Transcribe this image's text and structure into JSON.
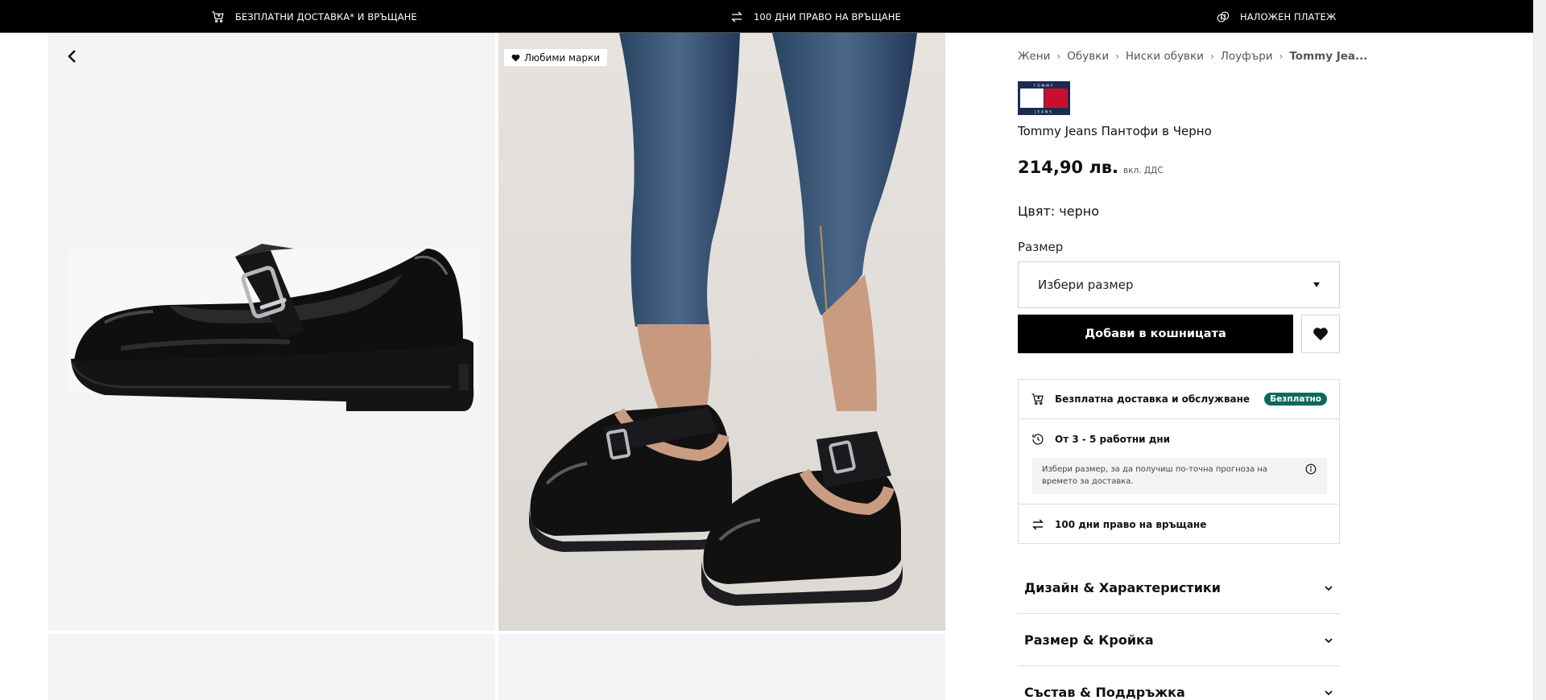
{
  "topbar": {
    "items": [
      {
        "icon": "cart-icon",
        "text": "БЕЗПЛАТНИ ДОСТАВКА* И ВРЪЩАНЕ"
      },
      {
        "icon": "return-arrows-icon",
        "text": "100 ДНИ ПРАВО НА ВРЪЩАНЕ"
      },
      {
        "icon": "coins-icon",
        "text": "НАЛОЖЕН ПЛАТЕЖ"
      }
    ]
  },
  "gallery": {
    "favorite_badge": "Любими марки"
  },
  "breadcrumbs": [
    "Жени",
    "Обувки",
    "Ниски обувки",
    "Лоуфъри",
    "Tommy Jea..."
  ],
  "brand_logo": {
    "text_top": "TOMMY",
    "text_bottom": "JEANS",
    "colors": {
      "navy": "#1b2a52",
      "red": "#c8102e",
      "white": "#ffffff"
    }
  },
  "product": {
    "name": "Tommy Jeans Пантофи в Черно",
    "price": "214,90 лв.",
    "vat_note": "вкл. ДДС",
    "color_line": "Цвят: черно"
  },
  "size": {
    "label": "Размер",
    "placeholder": "Избери размер"
  },
  "actions": {
    "add_to_cart": "Добави в кошницата"
  },
  "delivery": {
    "free_delivery": "Безплатна доставка и обслужване",
    "free_badge": "Безплатно",
    "delivery_time": "От 3 - 5 работни дни",
    "delivery_note": "Избери размер, за да получиш по-точна прогноза на времето за доставка.",
    "returns": "100 дни право на връщане"
  },
  "accordions": [
    "Дизайн & Характеристики",
    "Размер & Кройка",
    "Състав & Поддръжка"
  ],
  "colors": {
    "accent_green": "#0b6a58",
    "black": "#000000"
  }
}
